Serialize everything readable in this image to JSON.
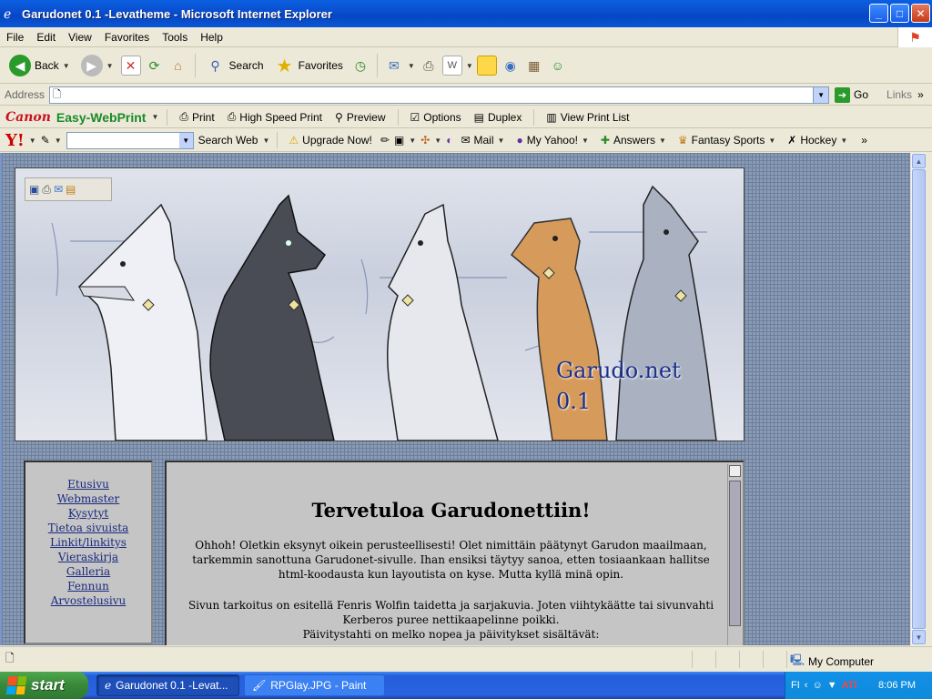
{
  "window": {
    "title": "Garudonet 0.1 -Levatheme - Microsoft Internet Explorer"
  },
  "menu": [
    "File",
    "Edit",
    "View",
    "Favorites",
    "Tools",
    "Help"
  ],
  "toolbar": {
    "back_label": "Back",
    "search_label": "Search",
    "favorites_label": "Favorites"
  },
  "address": {
    "label": "Address",
    "value": "",
    "go_label": "Go",
    "links_label": "Links"
  },
  "canon_bar": {
    "brand": "Canon",
    "product": "Easy-WebPrint",
    "print": "Print",
    "high_speed_print": "High Speed Print",
    "preview": "Preview",
    "options": "Options",
    "duplex": "Duplex",
    "view_print_list": "View Print List"
  },
  "yahoo_bar": {
    "logo": "Y!",
    "search_value": "",
    "search_web": "Search Web",
    "upgrade": "Upgrade Now!",
    "mail": "Mail",
    "my_yahoo": "My Yahoo!",
    "answers": "Answers",
    "fantasy_sports": "Fantasy Sports",
    "hockey": "Hockey"
  },
  "page": {
    "banner_title_line1": "Garudo.net",
    "banner_title_line2": "0.1",
    "nav_links": [
      "Etusivu",
      "Webmaster",
      "Kysytyt",
      "Tietoa sivuista",
      "Linkit/linkitys",
      "Vieraskirja",
      "Galleria",
      "Fennun",
      "Arvostelusivu"
    ],
    "heading": "Tervetuloa Garudonettiin!",
    "paragraph1": "Ohhoh! Oletkin eksynyt oikein perusteellisesti! Olet nimittäin päätynyt Garudon maailmaan, tarkemmin sanottuna Garudonet-sivulle. Ihan ensiksi täytyy sanoa, etten tosiaankaan hallitse html-koodausta kun layoutista on kyse. Mutta kyllä minä opin.",
    "paragraph2": "Sivun tarkoitus on esitellä Fenris Wolfin taidetta ja sarjakuvia. Joten viihtykäätte tai sivunvahti Kerberos puree nettikaapelinne poikki.",
    "paragraph3": "Päivitystahti on melko nopea ja päivitykset sisältävät:"
  },
  "status": {
    "zone": "My Computer"
  },
  "taskbar": {
    "start": "start",
    "task1": "Garudonet 0.1 -Levat...",
    "task2": "RPGlay.JPG - Paint",
    "lang": "FI",
    "clock": "8:06 PM"
  },
  "colors": {
    "titlebar": "#0a4fd0",
    "content_bg": "#8a9bb5",
    "panel_bg": "#c5c5c5",
    "link": "#1a2a80",
    "banner_text": "#1a2f8a"
  }
}
